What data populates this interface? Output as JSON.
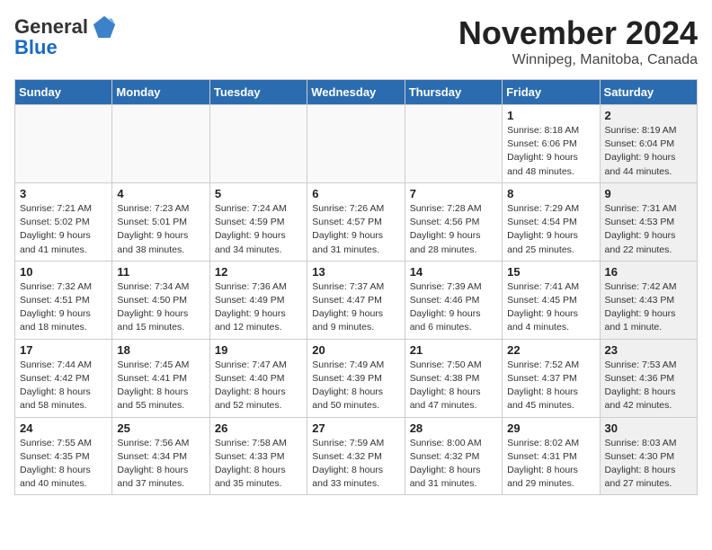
{
  "logo": {
    "general": "General",
    "blue": "Blue"
  },
  "title": "November 2024",
  "location": "Winnipeg, Manitoba, Canada",
  "headers": [
    "Sunday",
    "Monday",
    "Tuesday",
    "Wednesday",
    "Thursday",
    "Friday",
    "Saturday"
  ],
  "weeks": [
    [
      {
        "day": "",
        "info": "",
        "empty": true
      },
      {
        "day": "",
        "info": "",
        "empty": true
      },
      {
        "day": "",
        "info": "",
        "empty": true
      },
      {
        "day": "",
        "info": "",
        "empty": true
      },
      {
        "day": "",
        "info": "",
        "empty": true
      },
      {
        "day": "1",
        "info": "Sunrise: 8:18 AM\nSunset: 6:06 PM\nDaylight: 9 hours\nand 48 minutes.",
        "shaded": false
      },
      {
        "day": "2",
        "info": "Sunrise: 8:19 AM\nSunset: 6:04 PM\nDaylight: 9 hours\nand 44 minutes.",
        "shaded": true
      }
    ],
    [
      {
        "day": "3",
        "info": "Sunrise: 7:21 AM\nSunset: 5:02 PM\nDaylight: 9 hours\nand 41 minutes.",
        "shaded": false
      },
      {
        "day": "4",
        "info": "Sunrise: 7:23 AM\nSunset: 5:01 PM\nDaylight: 9 hours\nand 38 minutes.",
        "shaded": false
      },
      {
        "day": "5",
        "info": "Sunrise: 7:24 AM\nSunset: 4:59 PM\nDaylight: 9 hours\nand 34 minutes.",
        "shaded": false
      },
      {
        "day": "6",
        "info": "Sunrise: 7:26 AM\nSunset: 4:57 PM\nDaylight: 9 hours\nand 31 minutes.",
        "shaded": false
      },
      {
        "day": "7",
        "info": "Sunrise: 7:28 AM\nSunset: 4:56 PM\nDaylight: 9 hours\nand 28 minutes.",
        "shaded": false
      },
      {
        "day": "8",
        "info": "Sunrise: 7:29 AM\nSunset: 4:54 PM\nDaylight: 9 hours\nand 25 minutes.",
        "shaded": false
      },
      {
        "day": "9",
        "info": "Sunrise: 7:31 AM\nSunset: 4:53 PM\nDaylight: 9 hours\nand 22 minutes.",
        "shaded": true
      }
    ],
    [
      {
        "day": "10",
        "info": "Sunrise: 7:32 AM\nSunset: 4:51 PM\nDaylight: 9 hours\nand 18 minutes.",
        "shaded": false
      },
      {
        "day": "11",
        "info": "Sunrise: 7:34 AM\nSunset: 4:50 PM\nDaylight: 9 hours\nand 15 minutes.",
        "shaded": false
      },
      {
        "day": "12",
        "info": "Sunrise: 7:36 AM\nSunset: 4:49 PM\nDaylight: 9 hours\nand 12 minutes.",
        "shaded": false
      },
      {
        "day": "13",
        "info": "Sunrise: 7:37 AM\nSunset: 4:47 PM\nDaylight: 9 hours\nand 9 minutes.",
        "shaded": false
      },
      {
        "day": "14",
        "info": "Sunrise: 7:39 AM\nSunset: 4:46 PM\nDaylight: 9 hours\nand 6 minutes.",
        "shaded": false
      },
      {
        "day": "15",
        "info": "Sunrise: 7:41 AM\nSunset: 4:45 PM\nDaylight: 9 hours\nand 4 minutes.",
        "shaded": false
      },
      {
        "day": "16",
        "info": "Sunrise: 7:42 AM\nSunset: 4:43 PM\nDaylight: 9 hours\nand 1 minute.",
        "shaded": true
      }
    ],
    [
      {
        "day": "17",
        "info": "Sunrise: 7:44 AM\nSunset: 4:42 PM\nDaylight: 8 hours\nand 58 minutes.",
        "shaded": false
      },
      {
        "day": "18",
        "info": "Sunrise: 7:45 AM\nSunset: 4:41 PM\nDaylight: 8 hours\nand 55 minutes.",
        "shaded": false
      },
      {
        "day": "19",
        "info": "Sunrise: 7:47 AM\nSunset: 4:40 PM\nDaylight: 8 hours\nand 52 minutes.",
        "shaded": false
      },
      {
        "day": "20",
        "info": "Sunrise: 7:49 AM\nSunset: 4:39 PM\nDaylight: 8 hours\nand 50 minutes.",
        "shaded": false
      },
      {
        "day": "21",
        "info": "Sunrise: 7:50 AM\nSunset: 4:38 PM\nDaylight: 8 hours\nand 47 minutes.",
        "shaded": false
      },
      {
        "day": "22",
        "info": "Sunrise: 7:52 AM\nSunset: 4:37 PM\nDaylight: 8 hours\nand 45 minutes.",
        "shaded": false
      },
      {
        "day": "23",
        "info": "Sunrise: 7:53 AM\nSunset: 4:36 PM\nDaylight: 8 hours\nand 42 minutes.",
        "shaded": true
      }
    ],
    [
      {
        "day": "24",
        "info": "Sunrise: 7:55 AM\nSunset: 4:35 PM\nDaylight: 8 hours\nand 40 minutes.",
        "shaded": false
      },
      {
        "day": "25",
        "info": "Sunrise: 7:56 AM\nSunset: 4:34 PM\nDaylight: 8 hours\nand 37 minutes.",
        "shaded": false
      },
      {
        "day": "26",
        "info": "Sunrise: 7:58 AM\nSunset: 4:33 PM\nDaylight: 8 hours\nand 35 minutes.",
        "shaded": false
      },
      {
        "day": "27",
        "info": "Sunrise: 7:59 AM\nSunset: 4:32 PM\nDaylight: 8 hours\nand 33 minutes.",
        "shaded": false
      },
      {
        "day": "28",
        "info": "Sunrise: 8:00 AM\nSunset: 4:32 PM\nDaylight: 8 hours\nand 31 minutes.",
        "shaded": false
      },
      {
        "day": "29",
        "info": "Sunrise: 8:02 AM\nSunset: 4:31 PM\nDaylight: 8 hours\nand 29 minutes.",
        "shaded": false
      },
      {
        "day": "30",
        "info": "Sunrise: 8:03 AM\nSunset: 4:30 PM\nDaylight: 8 hours\nand 27 minutes.",
        "shaded": true
      }
    ]
  ]
}
